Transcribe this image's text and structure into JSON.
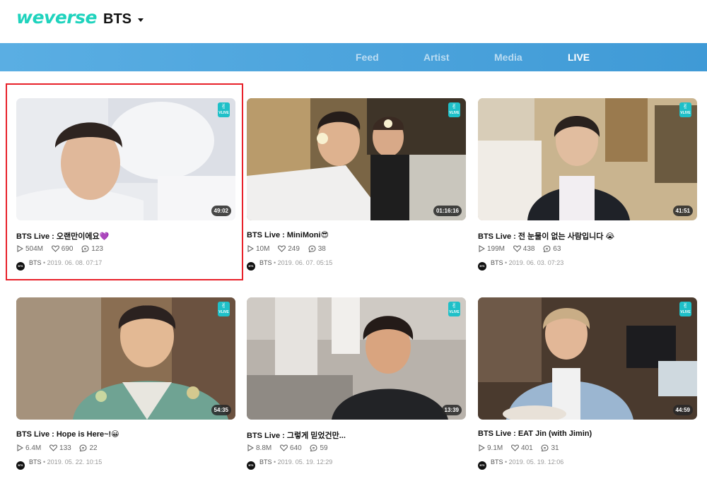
{
  "header": {
    "logo_text": "weverse",
    "artist": "BTS",
    "brand_color": "#1fd3bd"
  },
  "nav": {
    "tabs": [
      {
        "label": "Feed",
        "active": false
      },
      {
        "label": "Artist",
        "active": false
      },
      {
        "label": "Media",
        "active": false
      },
      {
        "label": "LIVE",
        "active": true
      }
    ]
  },
  "videos": [
    {
      "title": "BTS Live : 오랜만이에요💜",
      "duration": "49:02",
      "plays": "504M",
      "likes": "690",
      "comments": "123",
      "channel": "BTS",
      "date": "2019. 06. 08. 07:17"
    },
    {
      "title": "BTS Live : MiniMoni😎",
      "duration": "01:16:16",
      "plays": "10M",
      "likes": "249",
      "comments": "38",
      "channel": "BTS",
      "date": "2019. 06. 07. 05:15"
    },
    {
      "title": "BTS Live : 전 눈물이 없는 사람입니다 😭",
      "duration": "41:51",
      "plays": "199M",
      "likes": "438",
      "comments": "63",
      "channel": "BTS",
      "date": "2019. 06. 03. 07:23"
    },
    {
      "title": "BTS Live : Hope is Here~!😀",
      "duration": "54:35",
      "plays": "6.4M",
      "likes": "133",
      "comments": "22",
      "channel": "BTS",
      "date": "2019. 05. 22. 10:15"
    },
    {
      "title": "BTS Live : 그렇게 믿었건만...",
      "duration": "13:39",
      "plays": "8.8M",
      "likes": "640",
      "comments": "59",
      "channel": "BTS",
      "date": "2019. 05. 19. 12:29"
    },
    {
      "title": "BTS Live : EAT Jin (with Jimin)",
      "duration": "44:59",
      "plays": "9.1M",
      "likes": "401",
      "comments": "31",
      "channel": "BTS",
      "date": "2019. 05. 19. 12:06"
    }
  ],
  "badge": {
    "label": "VLIVE",
    "color": "#1fc0c8"
  },
  "icons": {
    "play": "play-icon",
    "like": "heart-icon",
    "comment": "comment-icon",
    "badge": "vlive-icon"
  },
  "highlight": {
    "color": "#e8212a",
    "target": "video-card-1"
  }
}
